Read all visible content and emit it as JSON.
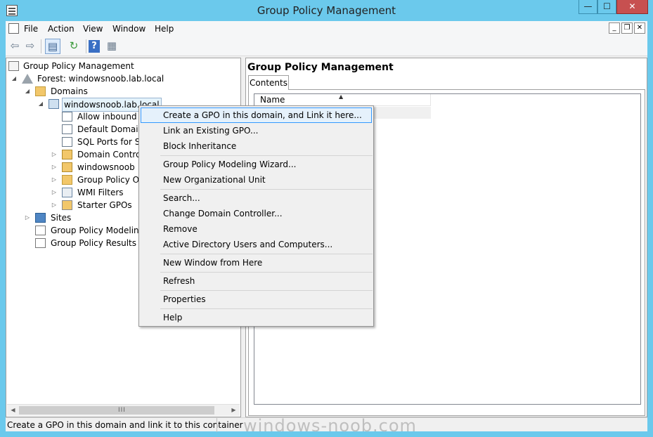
{
  "window": {
    "title": "Group Policy Management",
    "min_glyph": "—",
    "max_glyph": "☐",
    "close_glyph": "✕"
  },
  "menubar": {
    "items": [
      "File",
      "Action",
      "View",
      "Window",
      "Help"
    ],
    "mdi_min": "_",
    "mdi_restore": "❐",
    "mdi_close": "✕"
  },
  "toolbar": {
    "back_glyph": "⇦",
    "forward_glyph": "⇨",
    "show_tree_glyph": "▤",
    "refresh_glyph": "↻",
    "help_glyph": "?",
    "properties_glyph": "▦"
  },
  "tree": {
    "root": "Group Policy Management",
    "forest": "Forest: windowsnoob.lab.local",
    "domains": "Domains",
    "domain": "windowsnoob.lab.local",
    "gpo_allow": "Allow inbound f",
    "gpo_default": "Default Domain",
    "gpo_sql": "SQL Ports for Sys",
    "ou_dc": "Domain Controll",
    "ou_windowsnoob": "windowsnoob",
    "gpo_objects": "Group Policy Ob",
    "wmi": "WMI Filters",
    "starter": "Starter GPOs",
    "sites": "Sites",
    "modeling": "Group Policy Modeling",
    "results": "Group Policy Results",
    "arrow_expanded": "◢",
    "arrow_collapsed": "▷"
  },
  "scrollbar": {
    "left_glyph": "◀",
    "right_glyph": "▶",
    "grip": "III"
  },
  "right_pane": {
    "title": "Group Policy Management",
    "tab": "Contents",
    "column_name": "Name",
    "sort_glyph": "▲"
  },
  "context_menu": {
    "items": [
      "Create a GPO in this domain, and Link it here...",
      "Link an Existing GPO...",
      "Block Inheritance",
      "Group Policy Modeling Wizard...",
      "New Organizational Unit",
      "Search...",
      "Change Domain Controller...",
      "Remove",
      "Active Directory Users and Computers...",
      "New Window from Here",
      "Refresh",
      "Properties",
      "Help"
    ]
  },
  "status": {
    "text": "Create a GPO in this domain and link it to this container"
  },
  "watermark": "windows-noob.com",
  "colors": {
    "frame": "#6bc9ec",
    "close": "#c75050",
    "highlight_border": "#3399ff",
    "highlight_fill": "#e5f1fb"
  }
}
